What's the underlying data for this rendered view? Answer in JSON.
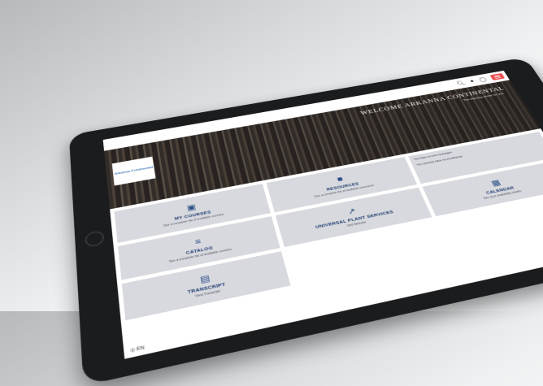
{
  "hero": {
    "title": "WELCOME ARKANNA CONTINENTAL",
    "subtitle": "The learning center for you",
    "logo_text": "Arkanna Continental"
  },
  "topbar": {
    "search_icon": "search-icon",
    "user_icon": "user-icon",
    "cart_icon": "cart-icon",
    "menu_icon": "menu-icon",
    "accent": "#e94f4f"
  },
  "tiles": [
    {
      "name": "MY COURSES",
      "desc": "See a complete list of available courses",
      "icon": "monitor-icon"
    },
    {
      "name": "RESOURCES",
      "desc": "See a complete list of available resources",
      "icon": "book-icon"
    },
    {
      "name": "CATALOG",
      "desc": "See a complete list of available courses",
      "icon": "catalog-icon"
    },
    {
      "name": "UNIVERSAL PLANT SERVICES",
      "desc": "Visit Website",
      "icon": "external-link-icon"
    },
    {
      "name": "CALENDAR",
      "desc": "See your availability details",
      "icon": "calendar-icon"
    },
    {
      "name": "TRANSCRIPT",
      "desc": "View Transcript",
      "icon": "transcript-icon"
    }
  ],
  "info_tile": {
    "line1": "You have no new messages",
    "line2": "You currently have no enrollments"
  },
  "footer": {
    "language": "EN"
  }
}
